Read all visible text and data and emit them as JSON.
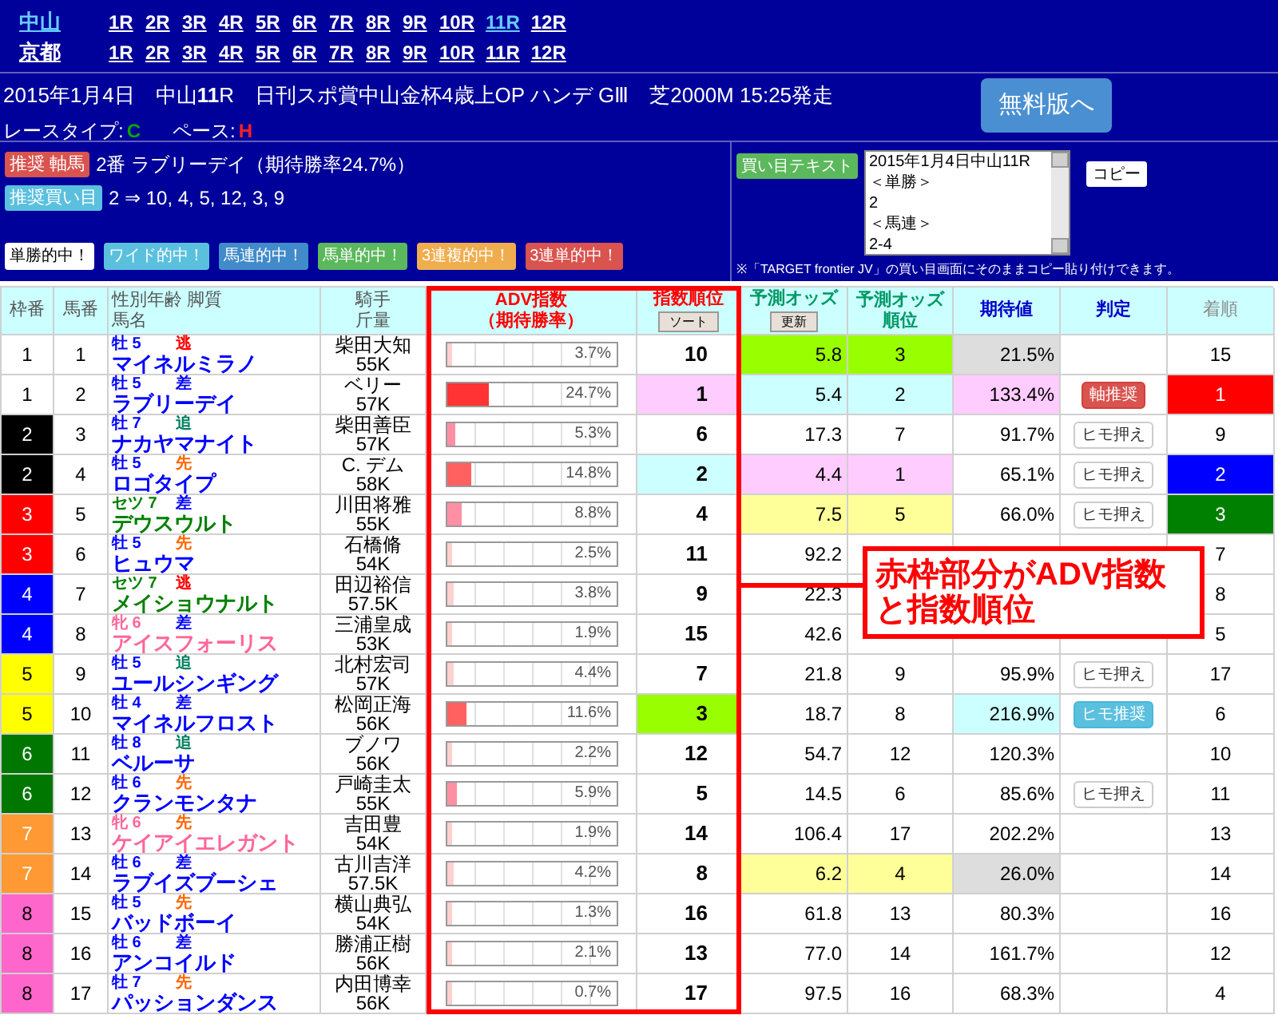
{
  "nav": {
    "venues": [
      {
        "name": "中山",
        "selected": true,
        "races": [
          {
            "label": "1R",
            "selected": false
          },
          {
            "label": "2R",
            "selected": false
          },
          {
            "label": "3R",
            "selected": false
          },
          {
            "label": "4R",
            "selected": false
          },
          {
            "label": "5R",
            "selected": false
          },
          {
            "label": "6R",
            "selected": false
          },
          {
            "label": "7R",
            "selected": false
          },
          {
            "label": "8R",
            "selected": false
          },
          {
            "label": "9R",
            "selected": false
          },
          {
            "label": "10R",
            "selected": false
          },
          {
            "label": "11R",
            "selected": true
          },
          {
            "label": "12R",
            "selected": false
          }
        ]
      },
      {
        "name": "京都",
        "selected": false,
        "races": [
          {
            "label": "1R",
            "selected": false
          },
          {
            "label": "2R",
            "selected": false
          },
          {
            "label": "3R",
            "selected": false
          },
          {
            "label": "4R",
            "selected": false
          },
          {
            "label": "5R",
            "selected": false
          },
          {
            "label": "6R",
            "selected": false
          },
          {
            "label": "7R",
            "selected": false
          },
          {
            "label": "8R",
            "selected": false
          },
          {
            "label": "9R",
            "selected": false
          },
          {
            "label": "10R",
            "selected": false
          },
          {
            "label": "11R",
            "selected": false
          },
          {
            "label": "12R",
            "selected": false
          }
        ]
      }
    ]
  },
  "race_info": {
    "title": "2015年1月4日　中山**11**R　日刊スポ賞中山金杯4歳上OP ハンデ GⅢ　芝2000M 15:25発走",
    "race_type_label": "レースタイプ:",
    "race_type": {
      "text": "C",
      "color": "#00aa00"
    },
    "pace_label": "ペース:",
    "pace": {
      "text": "H",
      "color": "#ff2020"
    },
    "free_button": "無料版へ"
  },
  "recommend": {
    "axis": {
      "badge": "推奨 軸馬",
      "text": "2番 ラブリーデイ（期待勝率24.7%）"
    },
    "bets": {
      "badge": "推奨買い目",
      "text": "2 ⇒ 10,  4, 5, 12, 3, 9"
    },
    "hit_badges": [
      {
        "text": "単勝的中！",
        "color": "#ffffff"
      },
      {
        "text": "ワイド的中！",
        "color": "#5bc0de"
      },
      {
        "text": "馬連的中！",
        "color": "#428bca"
      },
      {
        "text": "馬単的中！",
        "color": "#5cb85c"
      },
      {
        "text": "3連複的中！",
        "color": "#f0ad4e"
      },
      {
        "text": "3連単的中！",
        "color": "#d9534f"
      }
    ]
  },
  "bet_text": {
    "button": "買い目テキスト",
    "lines": [
      "2015年1月4日中山11R",
      "＜単勝＞",
      "2",
      "＜馬連＞",
      "2-4"
    ],
    "copy_button": "コピー",
    "note": "※「TARGET frontier JV」の買い目画面にそのままコピー貼り付けできます。"
  },
  "table": {
    "columns": [
      {
        "lines": [
          "枠番"
        ],
        "color": "#555555"
      },
      {
        "lines": [
          "馬番"
        ],
        "color": "#555555"
      },
      {
        "lines": [
          "性別年齢 脚質",
          "馬名"
        ],
        "color": "#555555"
      },
      {
        "lines": [
          "騎手",
          "斤量"
        ],
        "color": "#555555"
      },
      {
        "lines": [
          "ADV指数",
          "（期待勝率）"
        ],
        "color": "#ff0000"
      },
      {
        "lines": [
          "指数順位"
        ],
        "color": "#ff0000",
        "button": "ソート"
      },
      {
        "lines": [
          "予測オッズ"
        ],
        "color": "#009966",
        "button": "更新"
      },
      {
        "lines": [
          "予測オッズ",
          "順位"
        ],
        "color": "#009966"
      },
      {
        "lines": [
          "期待値"
        ],
        "color": "#0000cc"
      },
      {
        "lines": [
          "判定"
        ],
        "color": "#0000cc"
      },
      {
        "lines": [
          "着順"
        ],
        "color": "#888888"
      }
    ],
    "rows": [
      {
        "waku": {
          "text": "1",
          "color": "#ffffff"
        },
        "num": "1",
        "sex": {
          "text": "牡 5",
          "color": "#0000ff"
        },
        "style": {
          "text": "逃",
          "color": "#ff0000"
        },
        "name": "マイネルミラノ",
        "jockey": "柴田大知",
        "weight": "55K",
        "adv": {
          "text": "3.7%",
          "level": 0.037
        },
        "adv_rank": {
          "text": "10",
          "color": "#ffffff"
        },
        "odds": {
          "text": "5.8",
          "color": "#99ff00"
        },
        "odds_rank": {
          "text": "3",
          "color": "#99ff00"
        },
        "ev": {
          "text": "21.5%",
          "color": "#dddddd"
        },
        "judge": null,
        "finish": {
          "text": "15",
          "color": "#ffffff"
        }
      },
      {
        "waku": {
          "text": "1",
          "color": "#ffffff"
        },
        "num": "2",
        "sex": {
          "text": "牡 5",
          "color": "#0000ff"
        },
        "style": {
          "text": "差",
          "color": "#0000ff"
        },
        "name": "ラブリーデイ",
        "jockey": "ベリー",
        "weight": "57K",
        "adv": {
          "text": "24.7%",
          "level": 0.247
        },
        "adv_rank": {
          "text": "1",
          "color": "#ffccff"
        },
        "odds": {
          "text": "5.4",
          "color": "#ccffff"
        },
        "odds_rank": {
          "text": "2",
          "color": "#ccffff"
        },
        "ev": {
          "text": "133.4%",
          "color": "#ffccff"
        },
        "judge": {
          "kind": "main",
          "text": "軸推奨"
        },
        "finish": {
          "text": "1",
          "color": "#ff0000"
        }
      },
      {
        "waku": {
          "text": "2",
          "color": "#000000"
        },
        "num": "3",
        "sex": {
          "text": "牡 7",
          "color": "#0000ff"
        },
        "style": {
          "text": "追",
          "color": "#008060"
        },
        "name": "ナカヤマナイト",
        "jockey": "柴田善臣",
        "weight": "57K",
        "adv": {
          "text": "5.3%",
          "level": 0.053
        },
        "adv_rank": {
          "text": "6",
          "color": "#ffffff"
        },
        "odds": {
          "text": "17.3",
          "color": "#ffffff"
        },
        "odds_rank": {
          "text": "7",
          "color": "#ffffff"
        },
        "ev": {
          "text": "91.7%",
          "color": "#ffffff"
        },
        "judge": {
          "kind": "sub",
          "text": "ヒモ押え"
        },
        "finish": {
          "text": "9",
          "color": "#ffffff"
        }
      },
      {
        "waku": {
          "text": "2",
          "color": "#000000"
        },
        "num": "4",
        "sex": {
          "text": "牡 5",
          "color": "#0000ff"
        },
        "style": {
          "text": "先",
          "color": "#ff6600"
        },
        "name": "ロゴタイプ",
        "jockey": "C. デム",
        "weight": "58K",
        "adv": {
          "text": "14.8%",
          "level": 0.148
        },
        "adv_rank": {
          "text": "2",
          "color": "#ccffff"
        },
        "odds": {
          "text": "4.4",
          "color": "#ffccff"
        },
        "odds_rank": {
          "text": "1",
          "color": "#ffccff"
        },
        "ev": {
          "text": "65.1%",
          "color": "#ffffff"
        },
        "judge": {
          "kind": "sub",
          "text": "ヒモ押え"
        },
        "finish": {
          "text": "2",
          "color": "#0000ff"
        }
      },
      {
        "waku": {
          "text": "3",
          "color": "#ff0000"
        },
        "num": "5",
        "sex": {
          "text": "セツ 7",
          "color": "#008000"
        },
        "style": {
          "text": "差",
          "color": "#0000ff"
        },
        "name": "デウスウルト",
        "jockey": "川田将雅",
        "weight": "55K",
        "adv": {
          "text": "8.8%",
          "level": 0.088
        },
        "adv_rank": {
          "text": "4",
          "color": "#ffffff"
        },
        "odds": {
          "text": "7.5",
          "color": "#ffff99"
        },
        "odds_rank": {
          "text": "5",
          "color": "#ffff99"
        },
        "ev": {
          "text": "66.0%",
          "color": "#ffffff"
        },
        "judge": {
          "kind": "sub",
          "text": "ヒモ押え"
        },
        "finish": {
          "text": "3",
          "color": "#008000"
        }
      },
      {
        "waku": {
          "text": "3",
          "color": "#ff0000"
        },
        "num": "6",
        "sex": {
          "text": "牡 5",
          "color": "#0000ff"
        },
        "style": {
          "text": "先",
          "color": "#ff6600"
        },
        "name": "ヒュウマ",
        "jockey": "石橋脩",
        "weight": "54K",
        "adv": {
          "text": "2.5%",
          "level": 0.025
        },
        "adv_rank": {
          "text": "11",
          "color": "#ffffff"
        },
        "odds": {
          "text": "92.2",
          "color": "#ffffff"
        },
        "odds_rank": null,
        "ev": null,
        "judge": null,
        "finish": {
          "text": "7",
          "color": "#ffffff"
        }
      },
      {
        "waku": {
          "text": "4",
          "color": "#0000ff"
        },
        "num": "7",
        "sex": {
          "text": "セツ 7",
          "color": "#008000"
        },
        "style": {
          "text": "逃",
          "color": "#ff0000"
        },
        "name": "メイショウナルト",
        "jockey": "田辺裕信",
        "weight": "57.5K",
        "adv": {
          "text": "3.8%",
          "level": 0.038
        },
        "adv_rank": {
          "text": "9",
          "color": "#ffffff"
        },
        "odds": {
          "text": "22.3",
          "color": "#ffffff"
        },
        "odds_rank": null,
        "ev": null,
        "judge": null,
        "finish": {
          "text": "8",
          "color": "#ffffff"
        }
      },
      {
        "waku": {
          "text": "4",
          "color": "#0000ff"
        },
        "num": "8",
        "sex": {
          "text": "牝 6",
          "color": "#ff6699"
        },
        "style": {
          "text": "差",
          "color": "#0000ff"
        },
        "name": "アイスフォーリス",
        "jockey": "三浦皇成",
        "weight": "53K",
        "adv": {
          "text": "1.9%",
          "level": 0.019
        },
        "adv_rank": {
          "text": "15",
          "color": "#ffffff"
        },
        "odds": {
          "text": "42.6",
          "color": "#ffffff"
        },
        "odds_rank": null,
        "ev": null,
        "judge": null,
        "finish": {
          "text": "5",
          "color": "#ffffff"
        }
      },
      {
        "waku": {
          "text": "5",
          "color": "#ffff00"
        },
        "num": "9",
        "sex": {
          "text": "牡 5",
          "color": "#0000ff"
        },
        "style": {
          "text": "追",
          "color": "#008060"
        },
        "name": "ユールシンギング",
        "jockey": "北村宏司",
        "weight": "57K",
        "adv": {
          "text": "4.4%",
          "level": 0.044
        },
        "adv_rank": {
          "text": "7",
          "color": "#ffffff"
        },
        "odds": {
          "text": "21.8",
          "color": "#ffffff"
        },
        "odds_rank": {
          "text": "9",
          "color": "#ffffff"
        },
        "ev": {
          "text": "95.9%",
          "color": "#ffffff"
        },
        "judge": {
          "kind": "sub",
          "text": "ヒモ押え"
        },
        "finish": {
          "text": "17",
          "color": "#ffffff"
        }
      },
      {
        "waku": {
          "text": "5",
          "color": "#ffff00"
        },
        "num": "10",
        "sex": {
          "text": "牡 4",
          "color": "#0000ff"
        },
        "style": {
          "text": "差",
          "color": "#0000ff"
        },
        "name": "マイネルフロスト",
        "jockey": "松岡正海",
        "weight": "56K",
        "adv": {
          "text": "11.6%",
          "level": 0.116
        },
        "adv_rank": {
          "text": "3",
          "color": "#99ff00"
        },
        "odds": {
          "text": "18.7",
          "color": "#ffffff"
        },
        "odds_rank": {
          "text": "8",
          "color": "#ffffff"
        },
        "ev": {
          "text": "216.9%",
          "color": "#ccffff"
        },
        "judge": {
          "kind": "sub_rec",
          "text": "ヒモ推奨"
        },
        "finish": {
          "text": "6",
          "color": "#ffffff"
        }
      },
      {
        "waku": {
          "text": "6",
          "color": "#007700"
        },
        "num": "11",
        "sex": {
          "text": "牡 8",
          "color": "#0000ff"
        },
        "style": {
          "text": "追",
          "color": "#008060"
        },
        "name": "ベルーサ",
        "jockey": "ブノワ",
        "weight": "56K",
        "adv": {
          "text": "2.2%",
          "level": 0.022
        },
        "adv_rank": {
          "text": "12",
          "color": "#ffffff"
        },
        "odds": {
          "text": "54.7",
          "color": "#ffffff"
        },
        "odds_rank": {
          "text": "12",
          "color": "#ffffff"
        },
        "ev": {
          "text": "120.3%",
          "color": "#ffffff"
        },
        "judge": null,
        "finish": {
          "text": "10",
          "color": "#ffffff"
        }
      },
      {
        "waku": {
          "text": "6",
          "color": "#007700"
        },
        "num": "12",
        "sex": {
          "text": "牡 6",
          "color": "#0000ff"
        },
        "style": {
          "text": "先",
          "color": "#ff6600"
        },
        "name": "クランモンタナ",
        "jockey": "戸崎圭太",
        "weight": "55K",
        "adv": {
          "text": "5.9%",
          "level": 0.059
        },
        "adv_rank": {
          "text": "5",
          "color": "#ffffff"
        },
        "odds": {
          "text": "14.5",
          "color": "#ffffff"
        },
        "odds_rank": {
          "text": "6",
          "color": "#ffffff"
        },
        "ev": {
          "text": "85.6%",
          "color": "#ffffff"
        },
        "judge": {
          "kind": "sub",
          "text": "ヒモ押え"
        },
        "finish": {
          "text": "11",
          "color": "#ffffff"
        }
      },
      {
        "waku": {
          "text": "7",
          "color": "#ff9933"
        },
        "num": "13",
        "sex": {
          "text": "牝 6",
          "color": "#ff6699"
        },
        "style": {
          "text": "先",
          "color": "#ff6600"
        },
        "name": "ケイアイエレガント",
        "jockey": "吉田豊",
        "weight": "54K",
        "adv": {
          "text": "1.9%",
          "level": 0.019
        },
        "adv_rank": {
          "text": "14",
          "color": "#ffffff"
        },
        "odds": {
          "text": "106.4",
          "color": "#ffffff"
        },
        "odds_rank": {
          "text": "17",
          "color": "#ffffff"
        },
        "ev": {
          "text": "202.2%",
          "color": "#ffffff"
        },
        "judge": null,
        "finish": {
          "text": "13",
          "color": "#ffffff"
        }
      },
      {
        "waku": {
          "text": "7",
          "color": "#ff9933"
        },
        "num": "14",
        "sex": {
          "text": "牡 6",
          "color": "#0000ff"
        },
        "style": {
          "text": "差",
          "color": "#0000ff"
        },
        "name": "ラブイズブーシェ",
        "jockey": "古川吉洋",
        "weight": "57.5K",
        "adv": {
          "text": "4.2%",
          "level": 0.042
        },
        "adv_rank": {
          "text": "8",
          "color": "#ffffff"
        },
        "odds": {
          "text": "6.2",
          "color": "#ffff99"
        },
        "odds_rank": {
          "text": "4",
          "color": "#ffff99"
        },
        "ev": {
          "text": "26.0%",
          "color": "#dddddd"
        },
        "judge": null,
        "finish": {
          "text": "14",
          "color": "#ffffff"
        }
      },
      {
        "waku": {
          "text": "8",
          "color": "#ff66cc"
        },
        "num": "15",
        "sex": {
          "text": "牡 5",
          "color": "#0000ff"
        },
        "style": {
          "text": "先",
          "color": "#ff6600"
        },
        "name": "バッドボーイ",
        "jockey": "横山典弘",
        "weight": "54K",
        "adv": {
          "text": "1.3%",
          "level": 0.013
        },
        "adv_rank": {
          "text": "16",
          "color": "#ffffff"
        },
        "odds": {
          "text": "61.8",
          "color": "#ffffff"
        },
        "odds_rank": {
          "text": "13",
          "color": "#ffffff"
        },
        "ev": {
          "text": "80.3%",
          "color": "#ffffff"
        },
        "judge": null,
        "finish": {
          "text": "16",
          "color": "#ffffff"
        }
      },
      {
        "waku": {
          "text": "8",
          "color": "#ff66cc"
        },
        "num": "16",
        "sex": {
          "text": "牡 6",
          "color": "#0000ff"
        },
        "style": {
          "text": "差",
          "color": "#0000ff"
        },
        "name": "アンコイルド",
        "jockey": "勝浦正樹",
        "weight": "56K",
        "adv": {
          "text": "2.1%",
          "level": 0.021
        },
        "adv_rank": {
          "text": "13",
          "color": "#ffffff"
        },
        "odds": {
          "text": "77.0",
          "color": "#ffffff"
        },
        "odds_rank": {
          "text": "14",
          "color": "#ffffff"
        },
        "ev": {
          "text": "161.7%",
          "color": "#ffffff"
        },
        "judge": null,
        "finish": {
          "text": "12",
          "color": "#ffffff"
        }
      },
      {
        "waku": {
          "text": "8",
          "color": "#ff66cc"
        },
        "num": "17",
        "sex": {
          "text": "牡 7",
          "color": "#0000ff"
        },
        "style": {
          "text": "先",
          "color": "#ff6600"
        },
        "name": "パッションダンス",
        "jockey": "内田博幸",
        "weight": "56K",
        "adv": {
          "text": "0.7%",
          "level": 0.007
        },
        "adv_rank": {
          "text": "17",
          "color": "#ffffff"
        },
        "odds": {
          "text": "97.5",
          "color": "#ffffff"
        },
        "odds_rank": {
          "text": "16",
          "color": "#ffffff"
        },
        "ev": {
          "text": "68.3%",
          "color": "#ffffff"
        },
        "judge": null,
        "finish": {
          "text": "4",
          "color": "#ffffff"
        }
      }
    ]
  },
  "callout": {
    "lines": [
      "赤枠部分がADV指数",
      "と指数順位"
    ]
  }
}
